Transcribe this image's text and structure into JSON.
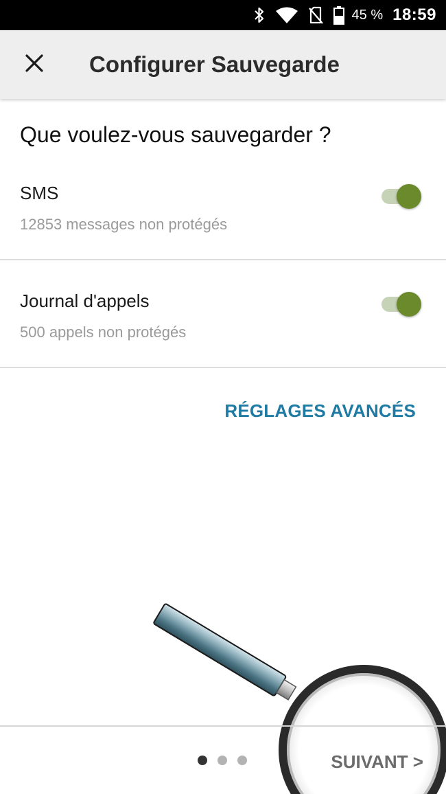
{
  "status_bar": {
    "battery_percent": "45 %",
    "time": "18:59",
    "icons": [
      "bluetooth-icon",
      "wifi-icon",
      "no-sim-icon",
      "battery-icon"
    ]
  },
  "toolbar": {
    "close_icon": "close-icon",
    "title": "Configurer Sauvegarde"
  },
  "main": {
    "question": "Que voulez-vous sauvegarder ?",
    "options": [
      {
        "title": "SMS",
        "subtitle": "12853 messages non protégés",
        "enabled": true
      },
      {
        "title": "Journal d'appels",
        "subtitle": "500 appels non protégés",
        "enabled": true
      }
    ],
    "advanced_label": "RÉGLAGES AVANCÉS"
  },
  "footer": {
    "pages": 3,
    "current_page": 1,
    "next_label": "SUIVANT >"
  },
  "colors": {
    "accent": "#1f7ba3",
    "toggle_on": "#6a8a2c",
    "toggle_track": "#c7d3b6"
  }
}
